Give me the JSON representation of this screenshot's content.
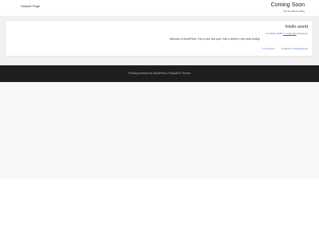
{
  "nav": {
    "items": [
      {
        "label": "Sample Page"
      }
    ]
  },
  "site": {
    "title": "Coming Soon",
    "description": "My WordPress Blog"
  },
  "post": {
    "title": "!Hello world",
    "meta": {
      "by_label": "by",
      "author": "admin-7f20ff",
      "timestamp": "1 month ago",
      "posted_label": "Posted on"
    },
    "excerpt": "Welcome to WordPress. This is your first post. Edit or delete it, then start writing!",
    "comments_link": "1 Comment",
    "category_label": "Posted in",
    "category": "Uncategorized"
  },
  "footer": {
    "credits": "Proudly powered by WordPress | PopularFX Theme"
  }
}
